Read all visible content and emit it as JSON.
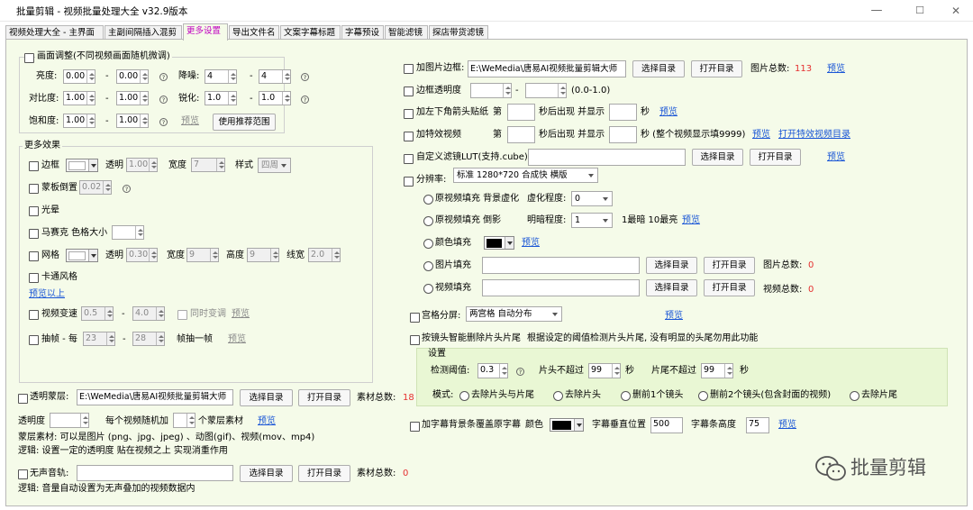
{
  "window": {
    "title": "批量剪辑 - 视频批量处理大全  v32.9版本",
    "minimize": "—",
    "maximize": "☐",
    "close": "✕"
  },
  "tabs": [
    "视频处理大全 - 主界面",
    "主副间隔插入混剪",
    "更多设置",
    "导出文件名",
    "文案字幕标题",
    "字幕预设",
    "智能滤镜",
    "探店带货滤镜"
  ],
  "left": {
    "frame_adjust": {
      "title": "画面调整(不同视频画面随机微调)",
      "brightness": {
        "label": "亮度:",
        "from": "0.00",
        "to": "0.00"
      },
      "denoise": {
        "label": "降噪:",
        "from": "4",
        "to": "4"
      },
      "contrast": {
        "label": "对比度:",
        "from": "1.00",
        "to": "1.00"
      },
      "sharpen": {
        "label": "锐化:",
        "from": "1.0",
        "to": "1.0"
      },
      "saturation": {
        "label": "饱和度:",
        "from": "1.00",
        "to": "1.00"
      },
      "preview": "预览",
      "recommend_btn": "使用推荐范围",
      "dash": "-"
    },
    "more_effects": {
      "title": "更多效果",
      "border": {
        "label": "边框",
        "opacity_label": "透明",
        "opacity": "1.00",
        "width_label": "宽度",
        "width": "7",
        "style_label": "样式",
        "style": "四周"
      },
      "mask_flip": {
        "label": "蒙板倒置",
        "value": "0.02"
      },
      "halo": {
        "label": "光晕"
      },
      "mosaic": {
        "label": "马赛克 色格大小",
        "value": ""
      },
      "grid": {
        "label": "网格",
        "opacity_label": "透明",
        "opacity": "0.30",
        "width_label": "宽度",
        "width": "9",
        "height_label": "高度",
        "height": "9",
        "line_label": "线宽",
        "line": "2.0"
      },
      "cartoon": {
        "label": "卡通风格"
      },
      "preview_above": "预览以上",
      "speed": {
        "label": "视频变速",
        "from": "0.5",
        "to": "4.0",
        "pitch": "同时变调",
        "preview": "预览"
      },
      "frame_drop": {
        "label": "抽帧 - 每",
        "from": "23",
        "to": "28",
        "suffix": "帧抽一帧",
        "preview": "预览"
      }
    },
    "overlay": {
      "label": "透明蒙层:",
      "path": "E:\\WeMedia\\唐易AI视频批量剪辑大师",
      "select": "选择目录",
      "open": "打开目录",
      "count_label": "素材总数:",
      "count": "18",
      "opacity_label": "透明度",
      "per_video": "每个视频随机加",
      "per_suffix": "个蒙层素材",
      "preview": "预览",
      "note1": "蒙层素材: 可以是图片 (png、jpg、jpeg) 、动图(gif)、视频(mov、mp4)",
      "note2": "逻辑: 设置一定的透明度 贴在视频之上 实现消重作用"
    },
    "silent": {
      "label": "无声音轨:",
      "path": "",
      "select": "选择目录",
      "open": "打开目录",
      "count_label": "素材总数:",
      "count": "0",
      "note": "逻辑: 音量自动设置为无声叠加的视频数据内"
    }
  },
  "right": {
    "image_border": {
      "label": "加图片边框:",
      "path": "E:\\WeMedia\\唐易AI视频批量剪辑大师",
      "select": "选择目录",
      "open": "打开目录",
      "count_label": "图片总数:",
      "count": "113",
      "preview": "预览"
    },
    "border_opacity": {
      "label": "边框透明度",
      "range": "(0.0-1.0)"
    },
    "arrow_sticker": {
      "label": "加左下角箭头贴纸",
      "first": "第",
      "mid": "秒后出现 并显示",
      "unit": "秒",
      "preview": "预览"
    },
    "effect_video": {
      "label": "加特效视频",
      "first": "第",
      "mid": "秒后出现 并显示",
      "unit": "秒 (整个视频显示填9999)",
      "preview": "预览",
      "open_link": "打开特效视频目录"
    },
    "lut": {
      "label": "自定义滤镜LUT(支持.cube)",
      "select": "选择目录",
      "open": "打开目录",
      "preview": "预览"
    },
    "resolution": {
      "label": "分辨率:",
      "value": "标准 1280*720 合成快 横版",
      "blur_fill": {
        "label": "原视频填充 背景虚化",
        "degree_label": "虚化程度:",
        "degree": "0"
      },
      "shadow_fill": {
        "label": "原视频填充 倒影",
        "bright_label": "明暗程度:",
        "bright": "1",
        "hint": "1最暗 10最亮",
        "preview": "预览"
      },
      "color_fill": {
        "label": "颜色填充",
        "preview": "预览"
      },
      "image_fill": {
        "label": "图片填充",
        "select": "选择目录",
        "open": "打开目录",
        "count_label": "图片总数:",
        "count": "0"
      },
      "video_fill": {
        "label": "视频填充",
        "select": "选择目录",
        "open": "打开目录",
        "count_label": "视频总数:",
        "count": "0"
      }
    },
    "split": {
      "label": "宫格分屏:",
      "value": "两宫格 自动分布",
      "preview": "预览"
    },
    "auto_trim": {
      "label": "按镜头智能删除片头片尾",
      "desc": "根据设定的阈值检测片头片尾, 没有明显的头尾勿用此功能",
      "settings_title": "设置",
      "threshold_label": "检测阈值:",
      "threshold": "0.3",
      "head_label": "片头不超过",
      "head": "99",
      "head_unit": "秒",
      "tail_label": "片尾不超过",
      "tail": "99",
      "tail_unit": "秒",
      "mode_label": "模式:",
      "modes": [
        "去除片头与片尾",
        "去除片头",
        "删前1个镜头",
        "删前2个镜头(包含封面的视频)",
        "去除片尾"
      ]
    },
    "subtitle_bar": {
      "label": "加字幕背景条覆盖原字幕",
      "color_label": "颜色",
      "pos_label": "字幕垂直位置",
      "pos": "500",
      "height_label": "字幕条高度",
      "height": "75",
      "preview": "预览"
    }
  },
  "watermark": {
    "text": "批量剪辑"
  },
  "colors": {
    "accent": "#c000c0",
    "link": "#1a56d6",
    "count_red": "#e53030",
    "panel_bg": "#f5fbe9"
  }
}
